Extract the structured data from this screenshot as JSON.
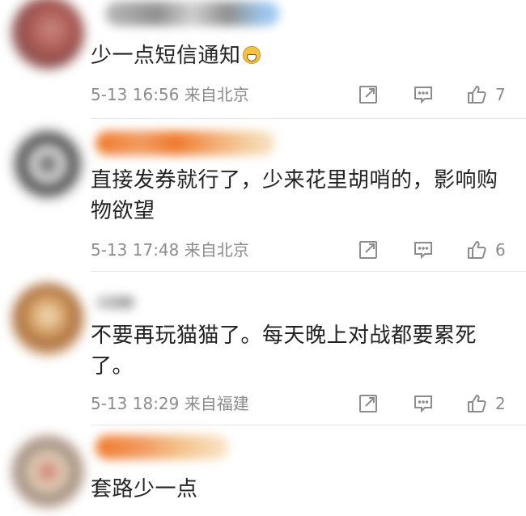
{
  "comments": [
    {
      "text": "少一点短信通知",
      "date": "5-13 16:56",
      "location": "来自北京",
      "likes": "7",
      "has_emoji": true
    },
    {
      "text": "直接发券就行了，少来花里胡哨的，影响购物欲望",
      "date": "5-13 17:48",
      "location": "来自北京",
      "likes": "6"
    },
    {
      "text": "不要再玩猫猫了。每天晚上对战都要累死了。",
      "date": "5-13 18:29",
      "location": "来自福建",
      "likes": "2"
    },
    {
      "text": "套路少一点"
    }
  ],
  "colors": {
    "meta_text": "#8c8c8c",
    "icon_stroke": "#8c8c8c",
    "divider": "#e6e6e6"
  },
  "icons": [
    "share-icon",
    "comment-icon",
    "like-icon",
    "grin-emoji-icon"
  ]
}
